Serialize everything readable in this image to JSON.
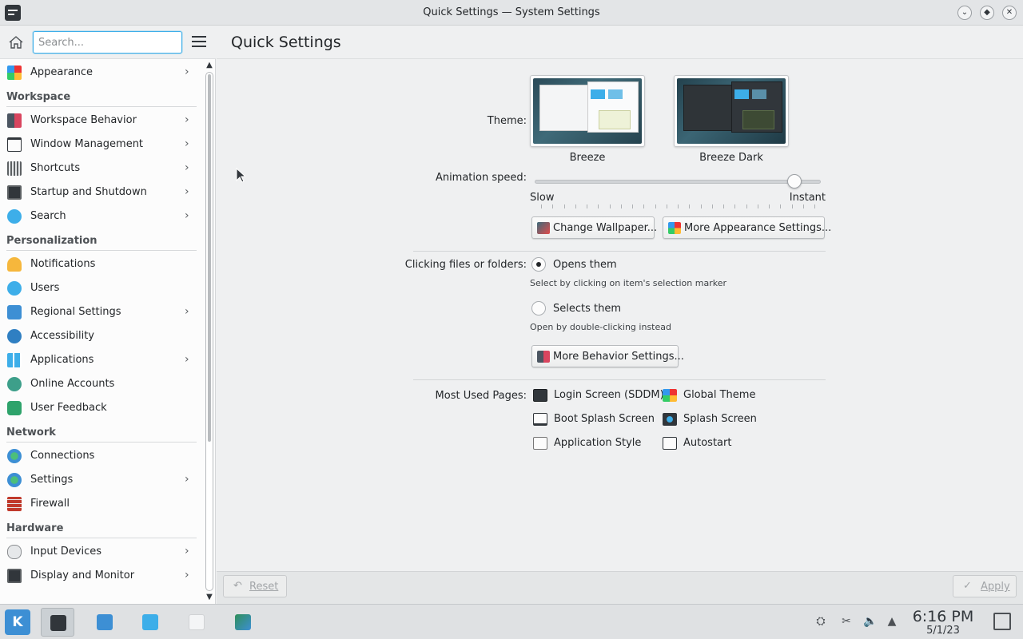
{
  "window": {
    "title": "Quick Settings — System Settings",
    "minimize_icon": "chevron-down-icon",
    "maximize_icon": "diamond-icon",
    "close_icon": "close-icon"
  },
  "sidebar": {
    "search_placeholder": "Search...",
    "items": [
      {
        "label": "Appearance",
        "icon": "appearance-icon",
        "has_children": true
      },
      {
        "section": "Workspace"
      },
      {
        "label": "Workspace Behavior",
        "icon": "workspace-behavior-icon",
        "has_children": true
      },
      {
        "label": "Window Management",
        "icon": "window-icon",
        "has_children": true
      },
      {
        "label": "Shortcuts",
        "icon": "keyboard-icon",
        "has_children": true
      },
      {
        "label": "Startup and Shutdown",
        "icon": "startup-icon",
        "has_children": true
      },
      {
        "label": "Search",
        "icon": "search-icon",
        "has_children": true
      },
      {
        "section": "Personalization"
      },
      {
        "label": "Notifications",
        "icon": "bell-icon",
        "has_children": false
      },
      {
        "label": "Users",
        "icon": "users-icon",
        "has_children": false
      },
      {
        "label": "Regional Settings",
        "icon": "regional-icon",
        "has_children": true
      },
      {
        "label": "Accessibility",
        "icon": "accessibility-icon",
        "has_children": false
      },
      {
        "label": "Applications",
        "icon": "applications-icon",
        "has_children": true
      },
      {
        "label": "Online Accounts",
        "icon": "online-accounts-icon",
        "has_children": false
      },
      {
        "label": "User Feedback",
        "icon": "feedback-icon",
        "has_children": false
      },
      {
        "section": "Network"
      },
      {
        "label": "Connections",
        "icon": "globe-icon",
        "has_children": false
      },
      {
        "label": "Settings",
        "icon": "globe-settings-icon",
        "has_children": true
      },
      {
        "label": "Firewall",
        "icon": "firewall-icon",
        "has_children": false
      },
      {
        "section": "Hardware"
      },
      {
        "label": "Input Devices",
        "icon": "mouse-icon",
        "has_children": true
      },
      {
        "label": "Display and Monitor",
        "icon": "monitor-icon",
        "has_children": true
      }
    ]
  },
  "main": {
    "page_title": "Quick Settings",
    "theme": {
      "label": "Theme:",
      "options": [
        {
          "name": "Breeze",
          "selected": false
        },
        {
          "name": "Breeze Dark",
          "selected": false
        }
      ]
    },
    "animation": {
      "label": "Animation speed:",
      "min_label": "Slow",
      "max_label": "Instant",
      "value_fraction": 0.93
    },
    "buttons": {
      "change_wallpaper": "Change Wallpaper...",
      "more_appearance": "More Appearance Settings...",
      "more_behavior": "More Behavior Settings..."
    },
    "clicking": {
      "label": "Clicking files or folders:",
      "option1": "Opens them",
      "option1_hint": "Select by clicking on item's selection marker",
      "option2": "Selects them",
      "option2_hint": "Open by double-clicking instead",
      "selected": "option1"
    },
    "most_used": {
      "label": "Most Used Pages:",
      "items": [
        "Login Screen (SDDM)",
        "Global Theme",
        "Boot Splash Screen",
        "Splash Screen",
        "Application Style",
        "Autostart"
      ]
    },
    "footer": {
      "reset": "Reset",
      "apply": "Apply"
    }
  },
  "taskbar": {
    "time": "6:16 PM",
    "date": "5/1/23",
    "launcher_icon": "kde-launcher-icon"
  },
  "colors": {
    "accent": "#3daee9",
    "background": "#eff0f1",
    "sidebar": "#fcfcfc"
  }
}
